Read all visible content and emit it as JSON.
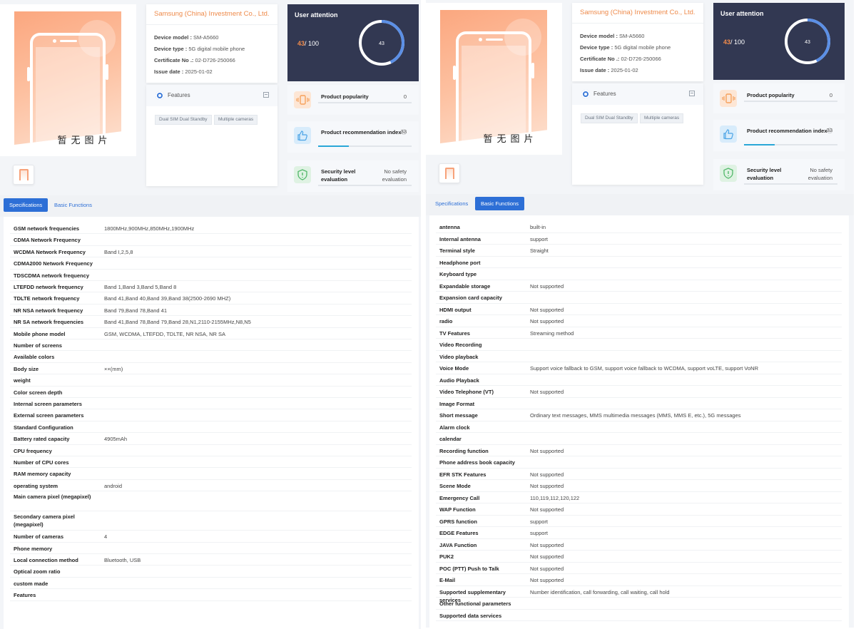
{
  "product": {
    "no_image_text": "暂无图片",
    "company": "Samsung (China) Investment Co., Ltd.",
    "device_model_label": "Device model :",
    "device_model": "SM-A5660",
    "device_type_label": "Device type :",
    "device_type": "5G digital mobile phone",
    "certificate_label": "Certificate No .:",
    "certificate_no": "02-D726-250066",
    "issue_date_label": "Issue date :",
    "issue_date": "2025-01-02"
  },
  "features": {
    "title": "Features",
    "tags": [
      "Dual SIM Dual Standby",
      "Multiple cameras"
    ]
  },
  "attention": {
    "title": "User attention",
    "score": "43",
    "max": "/ 100",
    "ring_value": "43",
    "fraction": 0.43
  },
  "metrics": [
    {
      "label": "Product popularity",
      "value": "0",
      "fill": 0.0,
      "icon": "vibrate-phone-icon",
      "color": "#f6a15c"
    },
    {
      "label": "Product recommendation index",
      "help": "ⓘ",
      "value": "33",
      "fill": 0.33,
      "icon": "thumbs-up-icon",
      "color": "#4aa3e6"
    },
    {
      "label": "Security level evaluation",
      "value": "No safety evaluation",
      "fill": 0.0,
      "icon": "shield-alert-icon",
      "color": "#52b86a"
    }
  ],
  "tabs": [
    "Specifications",
    "Basic Functions"
  ],
  "specifications": [
    {
      "label": "GSM network frequencies",
      "value": "1800MHz,900MHz,850MHz,1900MHz"
    },
    {
      "label": "CDMA Network Frequency",
      "value": ""
    },
    {
      "label": "WCDMA Network Frequency",
      "value": "Band I,2,5,8"
    },
    {
      "label": "CDMA2000 Network Frequency",
      "value": ""
    },
    {
      "label": "TDSCDMA network frequency",
      "value": ""
    },
    {
      "label": "LTEFDD network frequency",
      "value": "Band 1,Band 3,Band 5,Band 8"
    },
    {
      "label": "TDLTE network frequency",
      "value": "Band 41,Band 40,Band 39,Band 38(2500-2690 MHZ)"
    },
    {
      "label": "NR NSA network frequency",
      "value": "Band 79,Band 78,Band 41"
    },
    {
      "label": "NR SA network frequencies",
      "value": "Band 41,Band 78,Band 79,Band 28,N1,2110-2155MHz,N8,N5"
    },
    {
      "label": "Mobile phone model",
      "value": "GSM, WCDMA, LTEFDD, TDLTE, NR NSA, NR SA"
    },
    {
      "label": "Number of screens",
      "value": ""
    },
    {
      "label": "Available colors",
      "value": ""
    },
    {
      "label": "Body size",
      "value": "××(mm)"
    },
    {
      "label": "weight",
      "value": ""
    },
    {
      "label": "Color screen depth",
      "value": ""
    },
    {
      "label": "Internal screen parameters",
      "value": ""
    },
    {
      "label": "External screen parameters",
      "value": ""
    },
    {
      "label": "Standard Configuration",
      "value": ""
    },
    {
      "label": "Battery rated capacity",
      "value": "4905mAh"
    },
    {
      "label": "CPU frequency",
      "value": ""
    },
    {
      "label": "Number of CPU cores",
      "value": ""
    },
    {
      "label": "RAM memory capacity",
      "value": ""
    },
    {
      "label": "operating system",
      "value": "android"
    },
    {
      "label": "Main camera pixel (megapixel)",
      "value": ""
    },
    {
      "label": "Secondary camera pixel (megapixel)",
      "value": ""
    },
    {
      "label": "Number of cameras",
      "value": "4"
    },
    {
      "label": "Phone memory",
      "value": ""
    },
    {
      "label": "Local connection method",
      "value": "Bluetooth, USB"
    },
    {
      "label": "Optical zoom ratio",
      "value": ""
    },
    {
      "label": "custom made",
      "value": ""
    },
    {
      "label": "Features",
      "value": ""
    }
  ],
  "basic_functions": [
    {
      "label": "antenna",
      "value": "built-in"
    },
    {
      "label": "Internal antenna",
      "value": "support"
    },
    {
      "label": "Terminal style",
      "value": "Straight"
    },
    {
      "label": "Headphone port",
      "value": ""
    },
    {
      "label": "Keyboard type",
      "value": ""
    },
    {
      "label": "Expandable storage",
      "value": "Not supported"
    },
    {
      "label": "Expansion card capacity",
      "value": ""
    },
    {
      "label": "HDMI output",
      "value": "Not supported"
    },
    {
      "label": "radio",
      "value": "Not supported"
    },
    {
      "label": "TV Features",
      "value": "Streaming method"
    },
    {
      "label": "Video Recording",
      "value": ""
    },
    {
      "label": "Video playback",
      "value": ""
    },
    {
      "label": "Voice Mode",
      "value": "Support voice fallback to GSM, support voice fallback to WCDMA, support voLTE, support VoNR"
    },
    {
      "label": "Audio Playback",
      "value": ""
    },
    {
      "label": "Video Telephone (VT)",
      "value": "Not supported"
    },
    {
      "label": "Image Format",
      "value": ""
    },
    {
      "label": "Short message",
      "value": "Ordinary text messages, MMS multimedia messages (MMS, MMS E, etc.), 5G messages"
    },
    {
      "label": "Alarm clock",
      "value": ""
    },
    {
      "label": "calendar",
      "value": ""
    },
    {
      "label": "Recording function",
      "value": "Not supported"
    },
    {
      "label": "Phone address book capacity",
      "value": ""
    },
    {
      "label": "EFR STK Features",
      "value": "Not supported"
    },
    {
      "label": "Scene Mode",
      "value": "Not supported"
    },
    {
      "label": "Emergency Call",
      "value": "110,119,112,120,122"
    },
    {
      "label": "WAP Function",
      "value": "Not supported"
    },
    {
      "label": "GPRS function",
      "value": "support"
    },
    {
      "label": "EDGE Features",
      "value": "support"
    },
    {
      "label": "JAVA Function",
      "value": "Not supported"
    },
    {
      "label": "PUK2",
      "value": "Not supported"
    },
    {
      "label": "POC (PTT) Push to Talk",
      "value": "Not supported"
    },
    {
      "label": "E-Mail",
      "value": "Not supported"
    },
    {
      "label": "Supported supplementary services",
      "value": "Number identification, call forwarding, call waiting, call hold"
    },
    {
      "label": "Other functional parameters",
      "value": ""
    },
    {
      "label": "Supported data services",
      "value": ""
    }
  ]
}
